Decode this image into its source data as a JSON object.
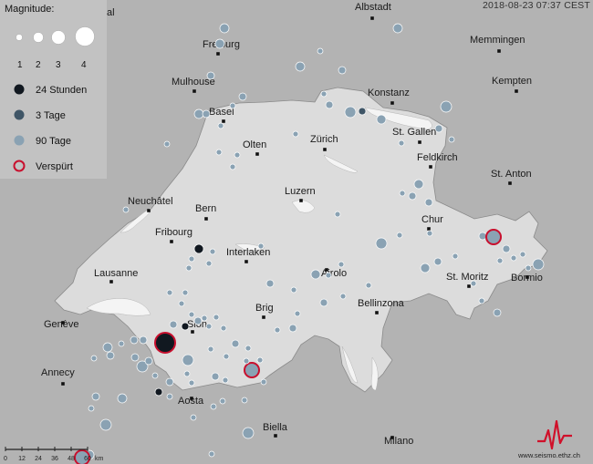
{
  "timestamp": "2018-08-23 07:37 CEST",
  "legend": {
    "title": "Magnitude:",
    "magnitudes": [
      "1",
      "2",
      "3",
      "4"
    ],
    "categories": [
      {
        "label": "24 Stunden",
        "color": "#111820"
      },
      {
        "label": "3 Tage",
        "color": "#3f5566"
      },
      {
        "label": "90 Tage",
        "color": "#8aa2b3"
      },
      {
        "label": "Verspürt",
        "color": "#c8102e"
      }
    ]
  },
  "cities": [
    "Albstadt",
    "Freiburg",
    "Memmingen",
    "Mulhouse",
    "Kempten",
    "Konstanz",
    "Basel",
    "St. Gallen",
    "Olten",
    "Zürich",
    "Feldkirch",
    "St. Anton",
    "Luzern",
    "Neuchâtel",
    "Bern",
    "Chur",
    "Fribourg",
    "Interlaken",
    "Lausanne",
    "Airolo",
    "St. Moritz",
    "Bormio",
    "Brig",
    "Genève",
    "Sion",
    "Bellinzona",
    "Annecy",
    "Aosta",
    "Biella",
    "Milano",
    "al"
  ],
  "scale": {
    "ticks": [
      "0",
      "12",
      "24",
      "36",
      "48",
      "60"
    ],
    "unit": "km"
  },
  "credit": "www.seismo.ethz.ch",
  "colors": {
    "land": "#b4b4b4",
    "switzerland": "#dadada",
    "lakes": "#f2f2f2",
    "quake_90d": "#8aa2b3",
    "quake_3d": "#3f5566",
    "quake_24h": "#111820",
    "felt_ring": "#c8102e"
  }
}
